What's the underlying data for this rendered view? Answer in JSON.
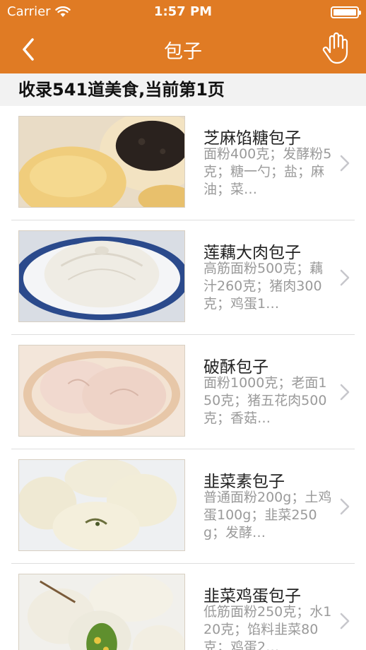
{
  "status_bar": {
    "carrier": "Carrier",
    "time": "1:57 PM",
    "wifi_icon": "wifi-icon",
    "battery_icon": "battery-icon"
  },
  "nav": {
    "title": "包子",
    "back_icon": "chevron-left-icon",
    "right_icon": "hand-icon"
  },
  "summary": "收录541道美食,当前第1页",
  "recipes": [
    {
      "name": "芝麻馅糖包子",
      "ingredients": "面粉400克；发酵粉5克；糖一勺；盐；麻油；菜…"
    },
    {
      "name": "莲藕大肉包子",
      "ingredients": "高筋面粉500克；藕汁260克；猪肉300克；鸡蛋1…"
    },
    {
      "name": "破酥包子",
      "ingredients": "面粉1000克；老面150克；猪五花肉500克；香菇…"
    },
    {
      "name": "韭菜素包子",
      "ingredients": "普通面粉200g；土鸡蛋100g；韭菜250g；发酵…"
    },
    {
      "name": "韭菜鸡蛋包子",
      "ingredients": "低筋面粉250克；水120克；馅料韭菜80克；鸡蛋2…"
    }
  ],
  "colors": {
    "brand": "#e07b24",
    "summary_bg": "#f2f2f2",
    "desc_text": "#9a9a9a"
  }
}
